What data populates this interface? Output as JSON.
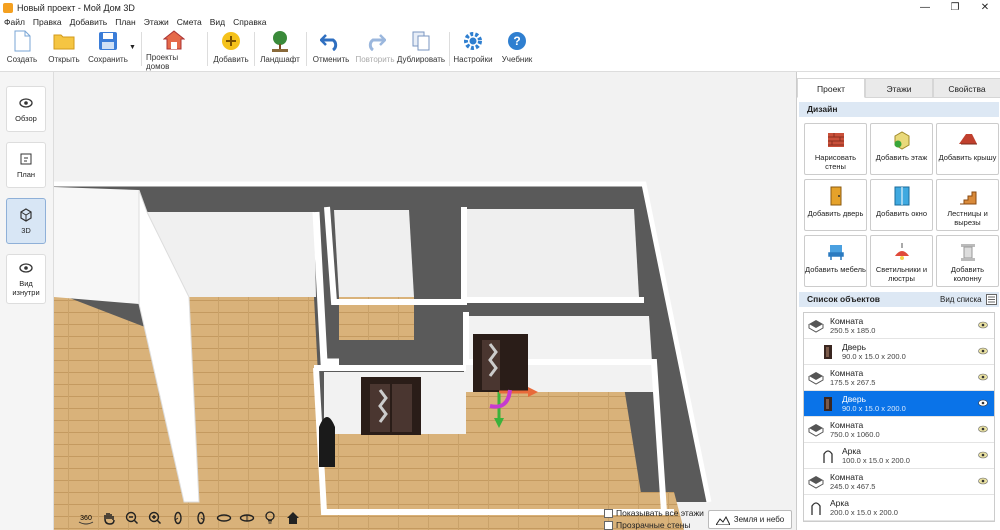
{
  "window": {
    "title": "Новый проект - Мой Дом 3D"
  },
  "menu": [
    "Файл",
    "Правка",
    "Добавить",
    "План",
    "Этажи",
    "Смета",
    "Вид",
    "Справка"
  ],
  "toolbar": {
    "create": "Создать",
    "open": "Открыть",
    "save": "Сохранить",
    "projects": "Проекты домов",
    "add": "Добавить",
    "landscape": "Ландшафт",
    "undo": "Отменить",
    "redo": "Повторить",
    "duplicate": "Дублировать",
    "settings": "Настройки",
    "tutorial": "Учебник"
  },
  "views": {
    "overview": "Обзор",
    "plan": "План",
    "threed": "3D",
    "inside": "Вид изнутри"
  },
  "bottom": {
    "show_floors": "Показывать все этажи",
    "transparent_walls": "Прозрачные стены",
    "earth_sky": "Земля и небо"
  },
  "panel": {
    "tabs": [
      "Проект",
      "Этажи",
      "Свойства"
    ],
    "design_title": "Дизайн",
    "design": [
      {
        "label": "Нарисовать стены",
        "icon": "brick-wall-icon"
      },
      {
        "label": "Добавить этаж",
        "icon": "add-floor-icon"
      },
      {
        "label": "Добавить крышу",
        "icon": "roof-icon"
      },
      {
        "label": "Добавить дверь",
        "icon": "door-icon"
      },
      {
        "label": "Добавить окно",
        "icon": "window-icon"
      },
      {
        "label": "Лестницы и вырезы",
        "icon": "stairs-icon"
      },
      {
        "label": "Добавить мебель",
        "icon": "chair-icon"
      },
      {
        "label": "Светильники и люстры",
        "icon": "lamp-icon"
      },
      {
        "label": "Добавить колонну",
        "icon": "column-icon"
      }
    ],
    "objects_title": "Список объектов",
    "list_view": "Вид списка",
    "objects": [
      {
        "name": "Комната",
        "size": "250.5 x 185.0",
        "kind": "room"
      },
      {
        "name": "Дверь",
        "size": "90.0 x 15.0 x 200.0",
        "kind": "door"
      },
      {
        "name": "Комната",
        "size": "175.5 x 267.5",
        "kind": "room"
      },
      {
        "name": "Дверь",
        "size": "90.0 x 15.0 x 200.0",
        "kind": "door"
      },
      {
        "name": "Комната",
        "size": "750.0 x 1060.0",
        "kind": "room"
      },
      {
        "name": "Арка",
        "size": "100.0 x 15.0 x 200.0",
        "kind": "arch"
      },
      {
        "name": "Комната",
        "size": "245.0 x 467.5",
        "kind": "room"
      },
      {
        "name": "Арка",
        "size": "200.0 x 15.0 x 200.0",
        "kind": "arch"
      }
    ]
  }
}
